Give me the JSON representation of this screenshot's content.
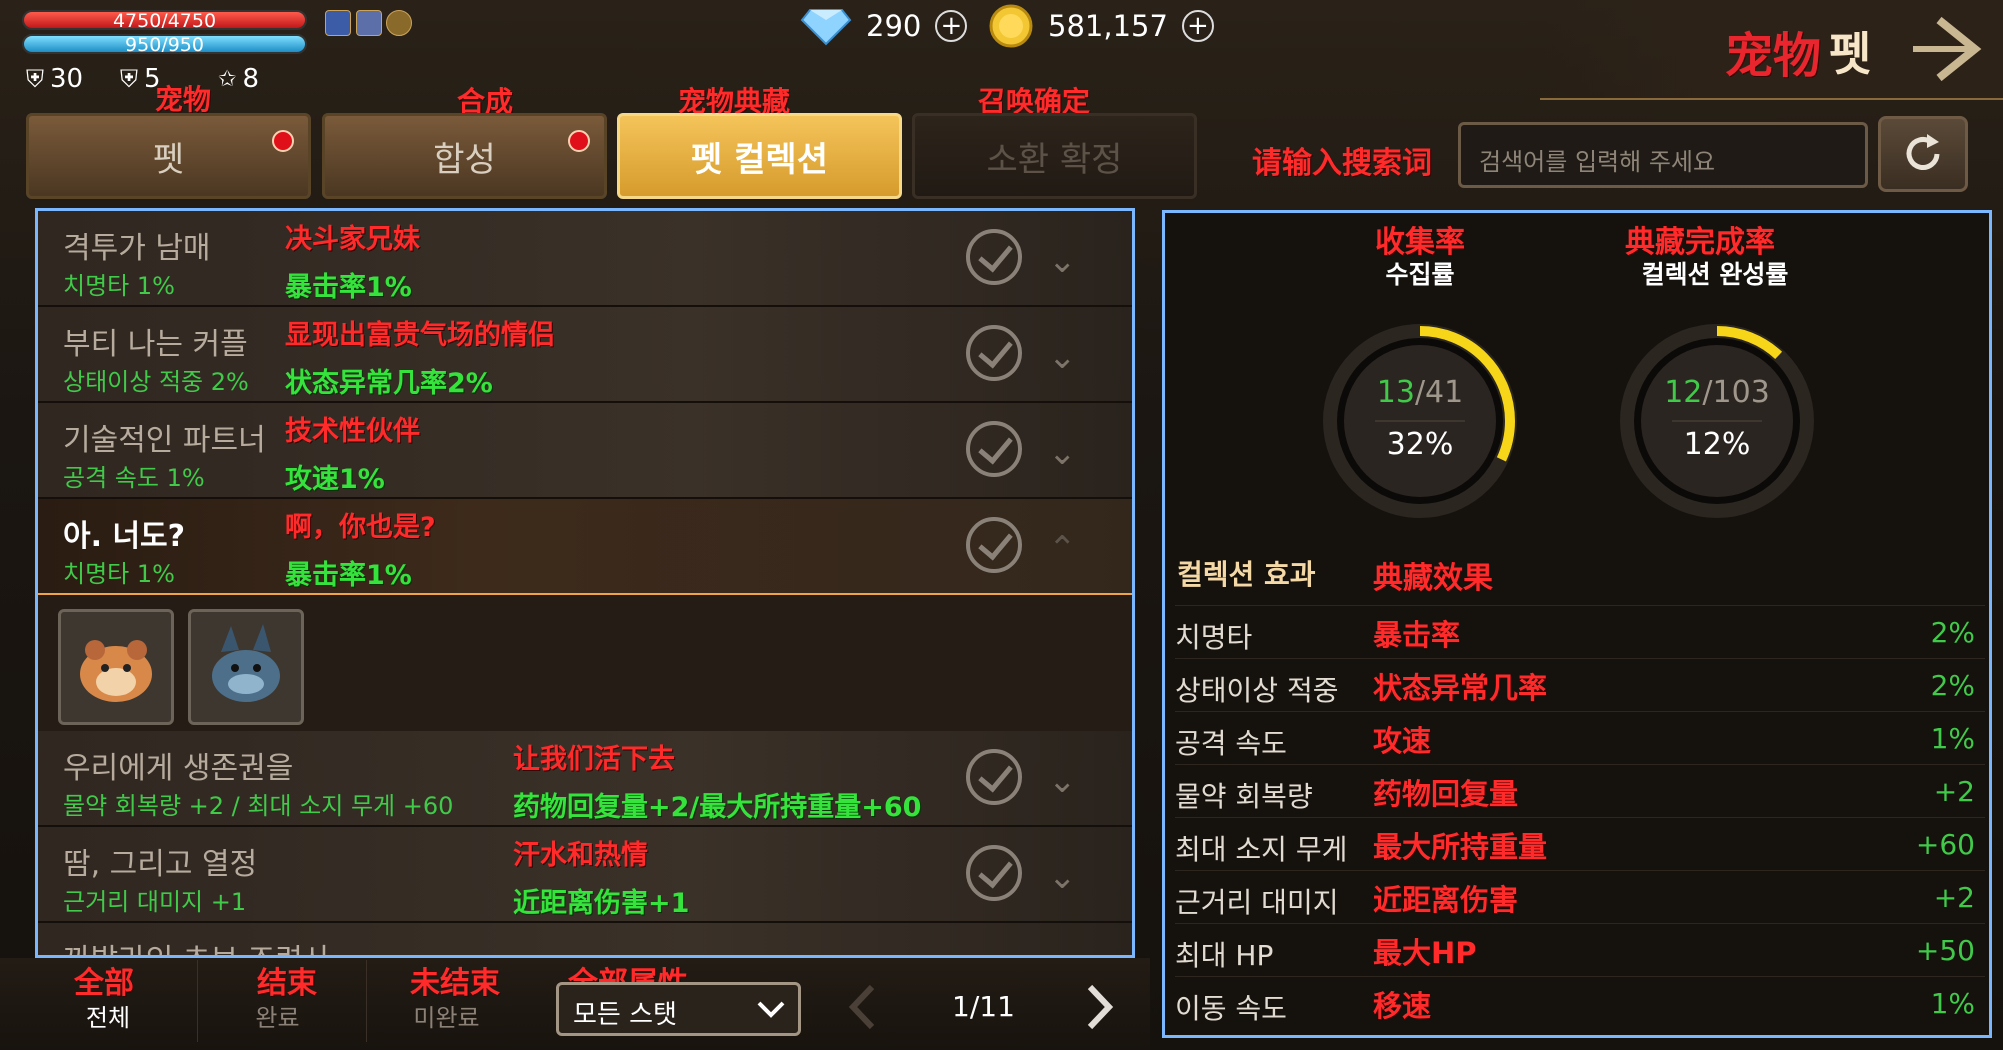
{
  "player": {
    "hp": "4750/4750",
    "mp": "950/950",
    "stats": [
      {
        "icon": "shield-icon",
        "value": "30"
      },
      {
        "icon": "badge-icon",
        "value": "5"
      },
      {
        "icon": "star-icon",
        "value": "8"
      }
    ]
  },
  "currency": {
    "gems": "290",
    "gold": "581,157"
  },
  "header": {
    "title_cn": "宠物",
    "title_kr": "펫"
  },
  "tabs": [
    {
      "label": "펫",
      "annotation": "宠物"
    },
    {
      "label": "합성",
      "annotation": "合成"
    },
    {
      "label": "펫 컬렉션",
      "annotation": "宠物典藏"
    },
    {
      "label": "소환 확정",
      "annotation": "召唤确定"
    }
  ],
  "search": {
    "annotation": "请输入搜索词",
    "placeholder": "검색어를 입력해 주세요"
  },
  "collections": [
    {
      "title": "격투가 남매",
      "title_cn": "决斗家兄妹",
      "effect": "치명타 1%",
      "effect_cn": "暴击率1%"
    },
    {
      "title": "부티 나는 커플",
      "title_cn": "显现出富贵气场的情侣",
      "effect": "상태이상 적중 2%",
      "effect_cn": "状态异常几率2%"
    },
    {
      "title": "기술적인 파트너",
      "title_cn": "技术性伙伴",
      "effect": "공격 속도 1%",
      "effect_cn": "攻速1%"
    },
    {
      "title": "아. 너도?",
      "title_cn": "啊，你也是?",
      "effect": "치명타 1%",
      "effect_cn": "暴击率1%"
    },
    {
      "title": "우리에게 생존권을",
      "title_cn": "让我们活下去",
      "effect": "물약 회복량 +2 / 최대 소지 무게 +60",
      "effect_cn": "药物回复量+2/最大所持重量+60"
    },
    {
      "title": "땀, 그리고 열정",
      "title_cn": "汗水和热情",
      "effect": "근거리 대미지 +1",
      "effect_cn": "近距离伤害+1"
    },
    {
      "title": "까발라인 초보 조련사",
      "title_cn": "",
      "effect": "",
      "effect_cn": ""
    }
  ],
  "filters": [
    {
      "label": "전체",
      "annotation": "全部"
    },
    {
      "label": "완료",
      "annotation": "结束"
    },
    {
      "label": "미완료",
      "annotation": "未结束"
    }
  ],
  "stat_filter": {
    "annotation": "全部属性",
    "value": "모든 스탯"
  },
  "pager": {
    "text": "1/11"
  },
  "summary": {
    "collect_label": "수집률",
    "collect_cn": "收集率",
    "collect_count": "13",
    "collect_total": "/41",
    "collect_pct": "32%",
    "collect_fraction": 0.32,
    "complete_label": "컬렉션 완성률",
    "complete_cn": "典藏完成率",
    "complete_count": "12",
    "complete_total": "/103",
    "complete_pct": "12%",
    "complete_fraction": 0.12
  },
  "effects": {
    "title": "컬렉션 효과",
    "title_cn": "典藏效果",
    "rows": [
      {
        "name": "치명타",
        "cn": "暴击率",
        "value": "2%"
      },
      {
        "name": "상태이상 적중",
        "cn": "状态异常几率",
        "value": "2%"
      },
      {
        "name": "공격 속도",
        "cn": "攻速",
        "value": "1%"
      },
      {
        "name": "물약 회복량",
        "cn": "药物回复量",
        "value": "+2"
      },
      {
        "name": "최대 소지 무게",
        "cn": "最大所持重量",
        "value": "+60"
      },
      {
        "name": "근거리 대미지",
        "cn": "近距离伤害",
        "value": "+2"
      },
      {
        "name": "최대 HP",
        "cn": "最大HP",
        "value": "+50"
      },
      {
        "name": "이동 속도",
        "cn": "移速",
        "value": "1%"
      }
    ]
  },
  "colors": {
    "accent": "#f2c04a",
    "annotation": "#ff2a2a",
    "green": "#41c94a",
    "panel_border": "#7bb7ff"
  }
}
